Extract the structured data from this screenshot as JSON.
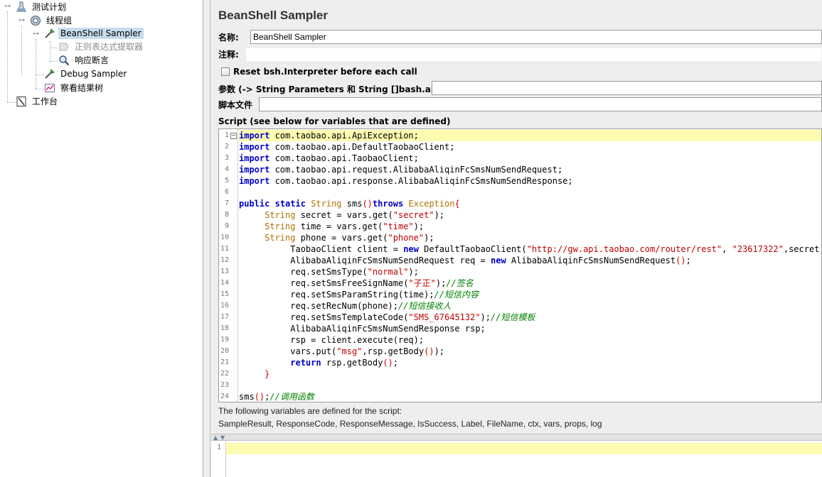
{
  "tree": {
    "items": [
      {
        "label": "测试计划",
        "icon": "test-plan-icon"
      },
      {
        "label": "线程组",
        "icon": "thread-group-icon"
      },
      {
        "label": "BeanShell Sampler",
        "icon": "sampler-icon"
      },
      {
        "label": "正则表达式提取器",
        "icon": "extractor-icon"
      },
      {
        "label": "响应断言",
        "icon": "assertion-icon"
      },
      {
        "label": "Debug Sampler",
        "icon": "sampler-icon"
      },
      {
        "label": "察看结果树",
        "icon": "results-tree-icon"
      },
      {
        "label": "工作台",
        "icon": "workbench-icon"
      }
    ]
  },
  "panel": {
    "title": "BeanShell Sampler",
    "name_label": "名称:",
    "name_value": "BeanShell Sampler",
    "comment_label": "注释:",
    "comment_value": "",
    "reset_label": "Reset bsh.Interpreter before each call",
    "params_label": "参数 (-> String Parameters 和 String []bash.args)",
    "params_value": "",
    "script_file_label": "脚本文件",
    "script_file_value": "",
    "script_heading": "Script (see below for variables that are defined)",
    "vars_note": "The following variables are defined for the script:",
    "vars_list": "SampleResult, ResponseCode, ResponseMessage, IsSuccess, Label, FileName, ctx, vars, props, log",
    "output_line": "1"
  },
  "code_lines": [
    [
      [
        "kw",
        "import"
      ],
      [
        "pl",
        " com.taobao.api.ApiException;"
      ]
    ],
    [
      [
        "kw",
        "import"
      ],
      [
        "pl",
        " com.taobao.api.DefaultTaobaoClient;"
      ]
    ],
    [
      [
        "kw",
        "import"
      ],
      [
        "pl",
        " com.taobao.api.TaobaoClient;"
      ]
    ],
    [
      [
        "kw",
        "import"
      ],
      [
        "pl",
        " com.taobao.api.request.AlibabaAliqinFcSmsNumSendRequest;"
      ]
    ],
    [
      [
        "kw",
        "import"
      ],
      [
        "pl",
        " com.taobao.api.response.AlibabaAliqinFcSmsNumSendResponse;"
      ]
    ],
    [],
    [
      [
        "kw",
        "public"
      ],
      [
        "pl",
        " "
      ],
      [
        "kw",
        "static"
      ],
      [
        "pl",
        " "
      ],
      [
        "ty",
        "String"
      ],
      [
        "pl",
        " sms"
      ],
      [
        "br",
        "()"
      ],
      [
        "kw",
        "throws"
      ],
      [
        "pl",
        " "
      ],
      [
        "ty",
        "Exception"
      ],
      [
        "br",
        "{"
      ]
    ],
    [
      [
        "pl",
        "     "
      ],
      [
        "ty",
        "String"
      ],
      [
        "pl",
        " secret = vars.get("
      ],
      [
        "st",
        "\"secret\""
      ],
      [
        "pl",
        ");"
      ]
    ],
    [
      [
        "pl",
        "     "
      ],
      [
        "ty",
        "String"
      ],
      [
        "pl",
        " time = vars.get("
      ],
      [
        "st",
        "\"time\""
      ],
      [
        "pl",
        ");"
      ]
    ],
    [
      [
        "pl",
        "     "
      ],
      [
        "ty",
        "String"
      ],
      [
        "pl",
        " phone = vars.get("
      ],
      [
        "st",
        "\"phone\""
      ],
      [
        "pl",
        ");"
      ]
    ],
    [
      [
        "pl",
        "          TaobaoClient client = "
      ],
      [
        "kw",
        "new"
      ],
      [
        "pl",
        " DefaultTaobaoClient("
      ],
      [
        "st",
        "\"http://gw.api.taobao.com/router/rest\""
      ],
      [
        "pl",
        ", "
      ],
      [
        "st",
        "\"23617322\""
      ],
      [
        "pl",
        ",secret);"
      ]
    ],
    [
      [
        "pl",
        "          AlibabaAliqinFcSmsNumSendRequest req = "
      ],
      [
        "kw",
        "new"
      ],
      [
        "pl",
        " AlibabaAliqinFcSmsNumSendRequest"
      ],
      [
        "br",
        "()"
      ],
      [
        "pl",
        ";"
      ]
    ],
    [
      [
        "pl",
        "          req.setSmsType("
      ],
      [
        "st",
        "\"normal\""
      ],
      [
        "pl",
        ");"
      ]
    ],
    [
      [
        "pl",
        "          req.setSmsFreeSignName("
      ],
      [
        "st",
        "\"子正\""
      ],
      [
        "pl",
        ");"
      ],
      [
        "cm",
        "//签名"
      ]
    ],
    [
      [
        "pl",
        "          req.setSmsParamString(time);"
      ],
      [
        "cm",
        "//短信内容"
      ]
    ],
    [
      [
        "pl",
        "          req.setRecNum(phone);"
      ],
      [
        "cm",
        "//短信接收人"
      ]
    ],
    [
      [
        "pl",
        "          req.setSmsTemplateCode("
      ],
      [
        "st",
        "\"SMS_67645132\""
      ],
      [
        "pl",
        ");"
      ],
      [
        "cm",
        "//短信模板"
      ]
    ],
    [
      [
        "pl",
        "          AlibabaAliqinFcSmsNumSendResponse rsp;"
      ]
    ],
    [
      [
        "pl",
        "          rsp = client.execute(req);"
      ]
    ],
    [
      [
        "pl",
        "          vars.put("
      ],
      [
        "st",
        "\"msg\""
      ],
      [
        "pl",
        ",rsp.getBody"
      ],
      [
        "br",
        "()"
      ],
      [
        "pl",
        ");"
      ]
    ],
    [
      [
        "pl",
        "          "
      ],
      [
        "kw",
        "return"
      ],
      [
        "pl",
        " rsp.getBody"
      ],
      [
        "br",
        "()"
      ],
      [
        "pl",
        ";"
      ]
    ],
    [
      [
        "pl",
        "     "
      ],
      [
        "br",
        "}"
      ]
    ],
    [],
    [
      [
        "pl",
        "sms"
      ],
      [
        "br",
        "()"
      ],
      [
        "pl",
        ";"
      ],
      [
        "cm",
        "//调用函数"
      ]
    ]
  ],
  "colors": {
    "selection": "#c8dcef",
    "current_line": "#fdfbb0",
    "keyword": "#0000cc",
    "string": "#c00000",
    "comment": "#008000",
    "type": "#b07000"
  }
}
